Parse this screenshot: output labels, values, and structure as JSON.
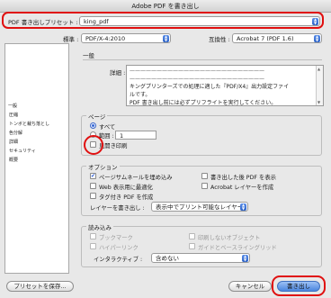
{
  "window": {
    "title": "Adobe PDF を書き出し"
  },
  "preset": {
    "label": "PDF 書き出しプリセット :",
    "value": "king_pdf"
  },
  "standard": {
    "label": "標準 :",
    "value": "PDF/X-4:2010"
  },
  "compat": {
    "label": "互換性 :",
    "value": "Acrobat 7 (PDF 1.6)"
  },
  "sidebar": {
    "items": [
      {
        "label": "一般"
      },
      {
        "label": "圧縮"
      },
      {
        "label": "トンボと裁ち落とし"
      },
      {
        "label": "色分解"
      },
      {
        "label": "詳細"
      },
      {
        "label": "セキュリティ"
      },
      {
        "label": "概要"
      }
    ]
  },
  "general": {
    "heading": "一般",
    "desc_label": "詳細 :",
    "desc_lines": [
      "—————————————————————————",
      "—————————————————————————",
      "キングプリンターズでの処理に適した『PDF/X4』出力設定ファイ",
      "ルです。",
      "PDF 書き出し前には必ずプリフライトを実行してください。"
    ]
  },
  "pages": {
    "title": "ページ",
    "all_label": "すべて",
    "range_label": "範囲 :",
    "range_value": "1",
    "spreads_label": "見開き印刷"
  },
  "options": {
    "title": "オプション",
    "embed_thumbnails": "ページサムネールを埋め込み",
    "view_after": "書き出した後 PDF を表示",
    "web_optimize": "Web 表示用に最適化",
    "acrobat_layers": "Acrobat レイヤーを作成",
    "tagged_pdf": "タグ付き PDF を作成",
    "layers_label": "レイヤーを書き出し :",
    "layers_value": "表示中でプリント可能なレイヤー"
  },
  "include": {
    "title": "読み込み",
    "bookmarks": "ブックマーク",
    "nonprinting": "印刷しないオブジェクト",
    "hyperlinks": "ハイパーリンク",
    "guides": "ガイドとベースライングリッド",
    "interactive_label": "インタラクティブ :",
    "interactive_value": "含めない"
  },
  "buttons": {
    "save_preset": "プリセットを保存...",
    "cancel": "キャンセル",
    "export": "書き出し"
  }
}
